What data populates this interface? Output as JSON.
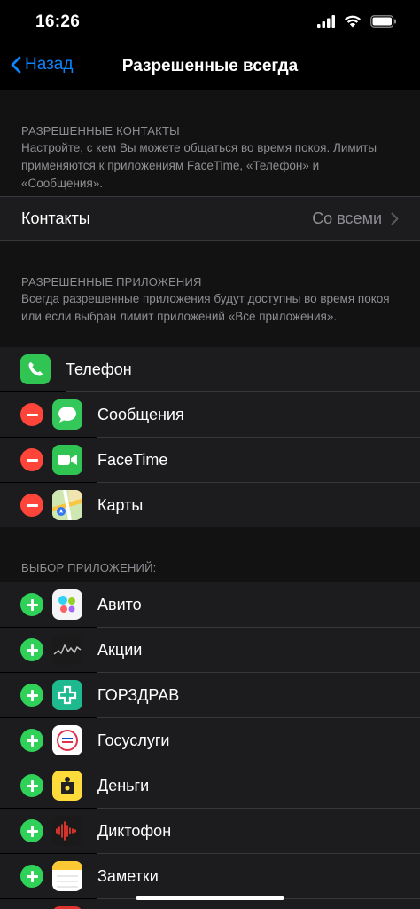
{
  "status": {
    "time": "16:26"
  },
  "nav": {
    "back_label": "Назад",
    "title": "Разрешенные всегда"
  },
  "contacts_section": {
    "title": "РАЗРЕШЕННЫЕ КОНТАКТЫ",
    "description": "Настройте, с кем Вы можете общаться во время покоя. Лимиты применяются к приложениям FaceTime, «Телефон» и «Сообщения».",
    "row_label": "Контакты",
    "row_value": "Со всеми"
  },
  "allowed_section": {
    "title": "РАЗРЕШЕННЫЕ ПРИЛОЖЕНИЯ",
    "description": "Всегда разрешенные приложения будут доступны во время покоя или если выбран лимит приложений «Все приложения».",
    "items": [
      {
        "label": "Телефон",
        "icon": "phone-icon",
        "removable": false
      },
      {
        "label": "Сообщения",
        "icon": "messages-icon",
        "removable": true
      },
      {
        "label": "FaceTime",
        "icon": "facetime-icon",
        "removable": true
      },
      {
        "label": "Карты",
        "icon": "maps-icon",
        "removable": true
      }
    ]
  },
  "choose_section": {
    "title": "ВЫБОР ПРИЛОЖЕНИЙ:",
    "items": [
      {
        "label": "Авито",
        "icon": "avito-icon"
      },
      {
        "label": "Акции",
        "icon": "stocks-icon"
      },
      {
        "label": "ГОРЗДРАВ",
        "icon": "gorzdrav-icon"
      },
      {
        "label": "Госуслуги",
        "icon": "gosuslugi-icon"
      },
      {
        "label": "Деньги",
        "icon": "money-icon"
      },
      {
        "label": "Диктофон",
        "icon": "voice-memos-icon"
      },
      {
        "label": "Заметки",
        "icon": "notes-icon"
      },
      {
        "label": "",
        "icon": "app-icon"
      }
    ]
  },
  "colors": {
    "accent": "#0a84ff",
    "add": "#30d158",
    "remove": "#ff453a",
    "cell": "#1c1c1e",
    "group_header": "#121212"
  }
}
